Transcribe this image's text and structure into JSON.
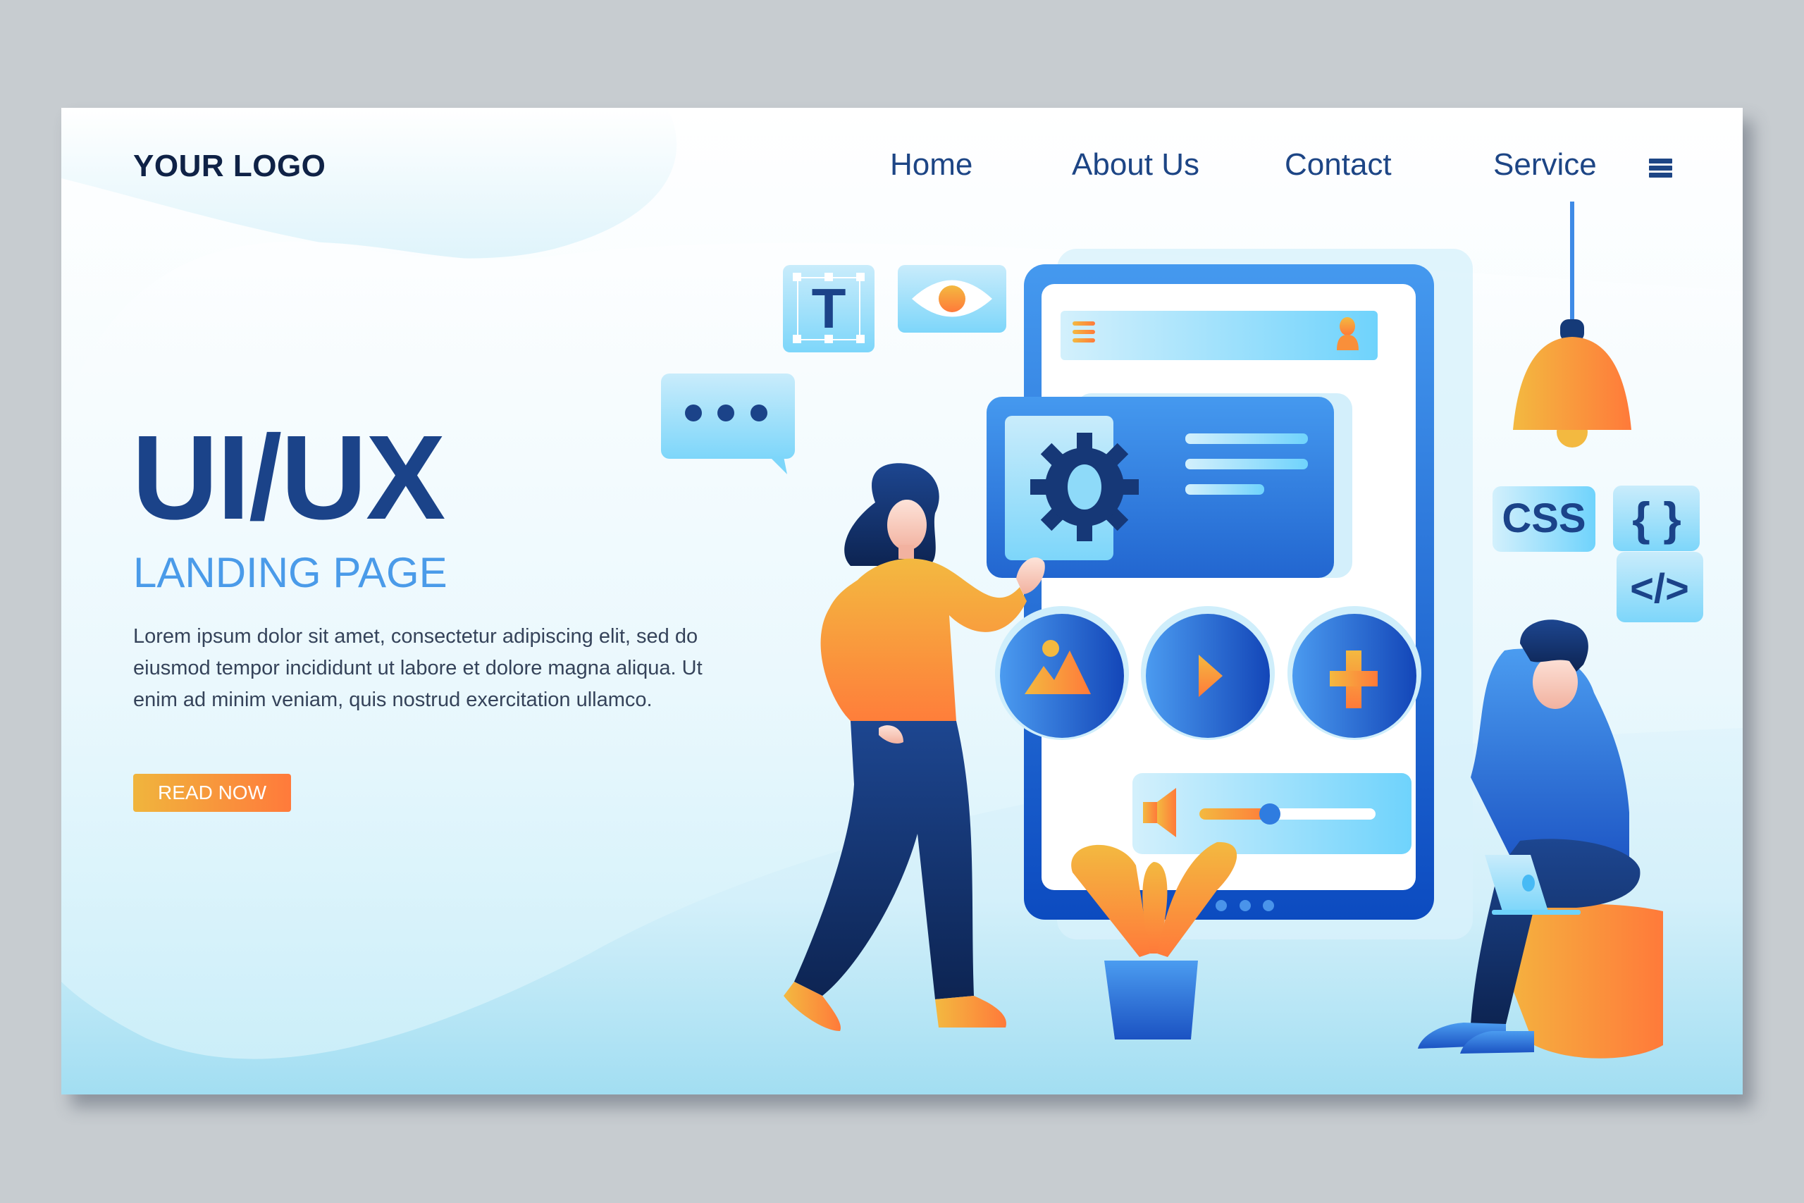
{
  "header": {
    "logo": "YOUR LOGO",
    "nav": [
      {
        "label": "Home"
      },
      {
        "label": "About Us"
      },
      {
        "label": "Contact"
      },
      {
        "label": "Service"
      }
    ],
    "menu_icon": "hamburger-menu-icon"
  },
  "hero": {
    "title": "UI/UX",
    "subtitle": "LANDING PAGE",
    "body": "Lorem ipsum dolor sit amet, consectetur adipiscing elit, sed do eiusmod tempor incididunt ut labore et dolore magna aliqua. Ut enim ad minim veniam, quis nostrud exercitation ullamco.",
    "cta_label": "READ NOW"
  },
  "illustration": {
    "text_tool_glyph": "T",
    "css_tag": "CSS",
    "braces_tag": "{ }",
    "code_tag": "</>",
    "volume_level": 0.4,
    "icons": [
      "text-tool-icon",
      "eye-icon",
      "chat-bubble-icon",
      "gear-icon",
      "image-icon",
      "play-icon",
      "plus-icon",
      "volume-icon",
      "user-icon",
      "menu-lines-icon",
      "lamp-icon",
      "plant-icon",
      "laptop-icon"
    ]
  },
  "colors": {
    "brand_dark": "#1b4389",
    "brand_light": "#4a9be9",
    "accent_orange": "#ff7a3b",
    "accent_yellow": "#f0b53d",
    "frame_bg": "#c7ccd0"
  }
}
